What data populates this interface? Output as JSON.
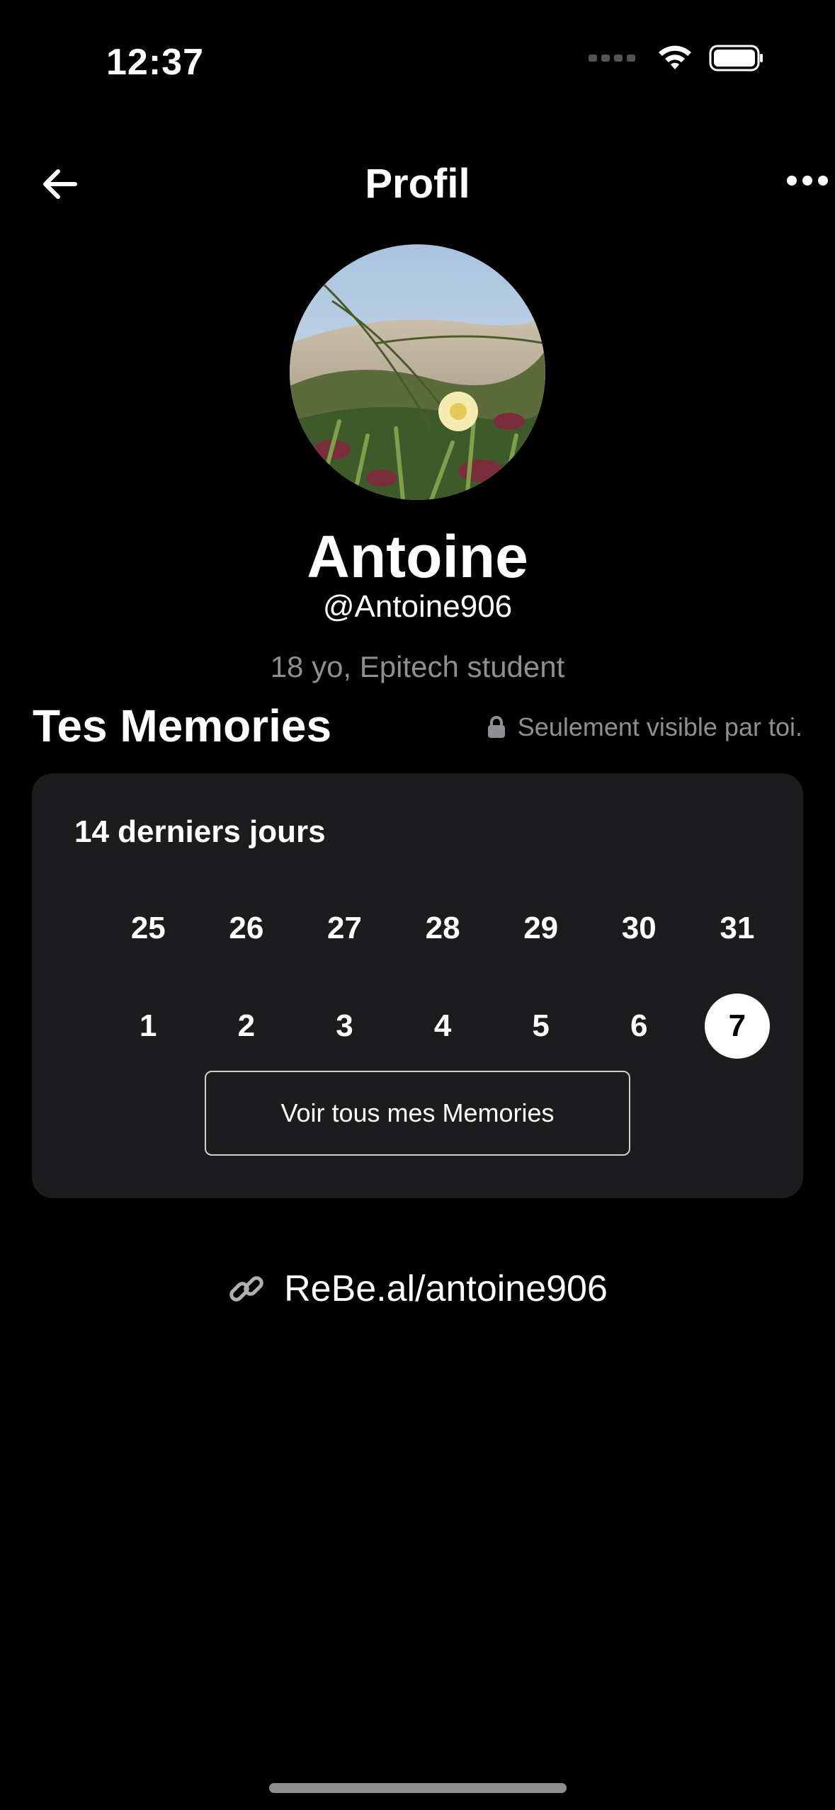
{
  "status_bar": {
    "time": "12:37",
    "icons": [
      "cellular-signal-icon",
      "wifi-icon",
      "battery-icon"
    ]
  },
  "nav": {
    "title": "Profil",
    "back_icon": "arrow-left-icon",
    "more_icon": "ellipsis-icon"
  },
  "profile": {
    "name": "Antoine",
    "handle": "@Antoine906",
    "bio": "18 yo, Epitech student"
  },
  "memories": {
    "title": "Tes Memories",
    "privacy_note": "Seulement visible par toi.",
    "card_subtitle": "14 derniers jours",
    "days": [
      "25",
      "26",
      "27",
      "28",
      "29",
      "30",
      "31",
      "1",
      "2",
      "3",
      "4",
      "5",
      "6",
      "7"
    ],
    "selected_day": "7",
    "view_all_label": "Voir tous mes Memories"
  },
  "link": {
    "url_text": "ReBe.al/antoine906",
    "icon": "link-icon"
  },
  "colors": {
    "background": "#000000",
    "card": "#1c1c1e",
    "secondary_text": "#8e8e93",
    "selected_day_bg": "#ffffff"
  }
}
